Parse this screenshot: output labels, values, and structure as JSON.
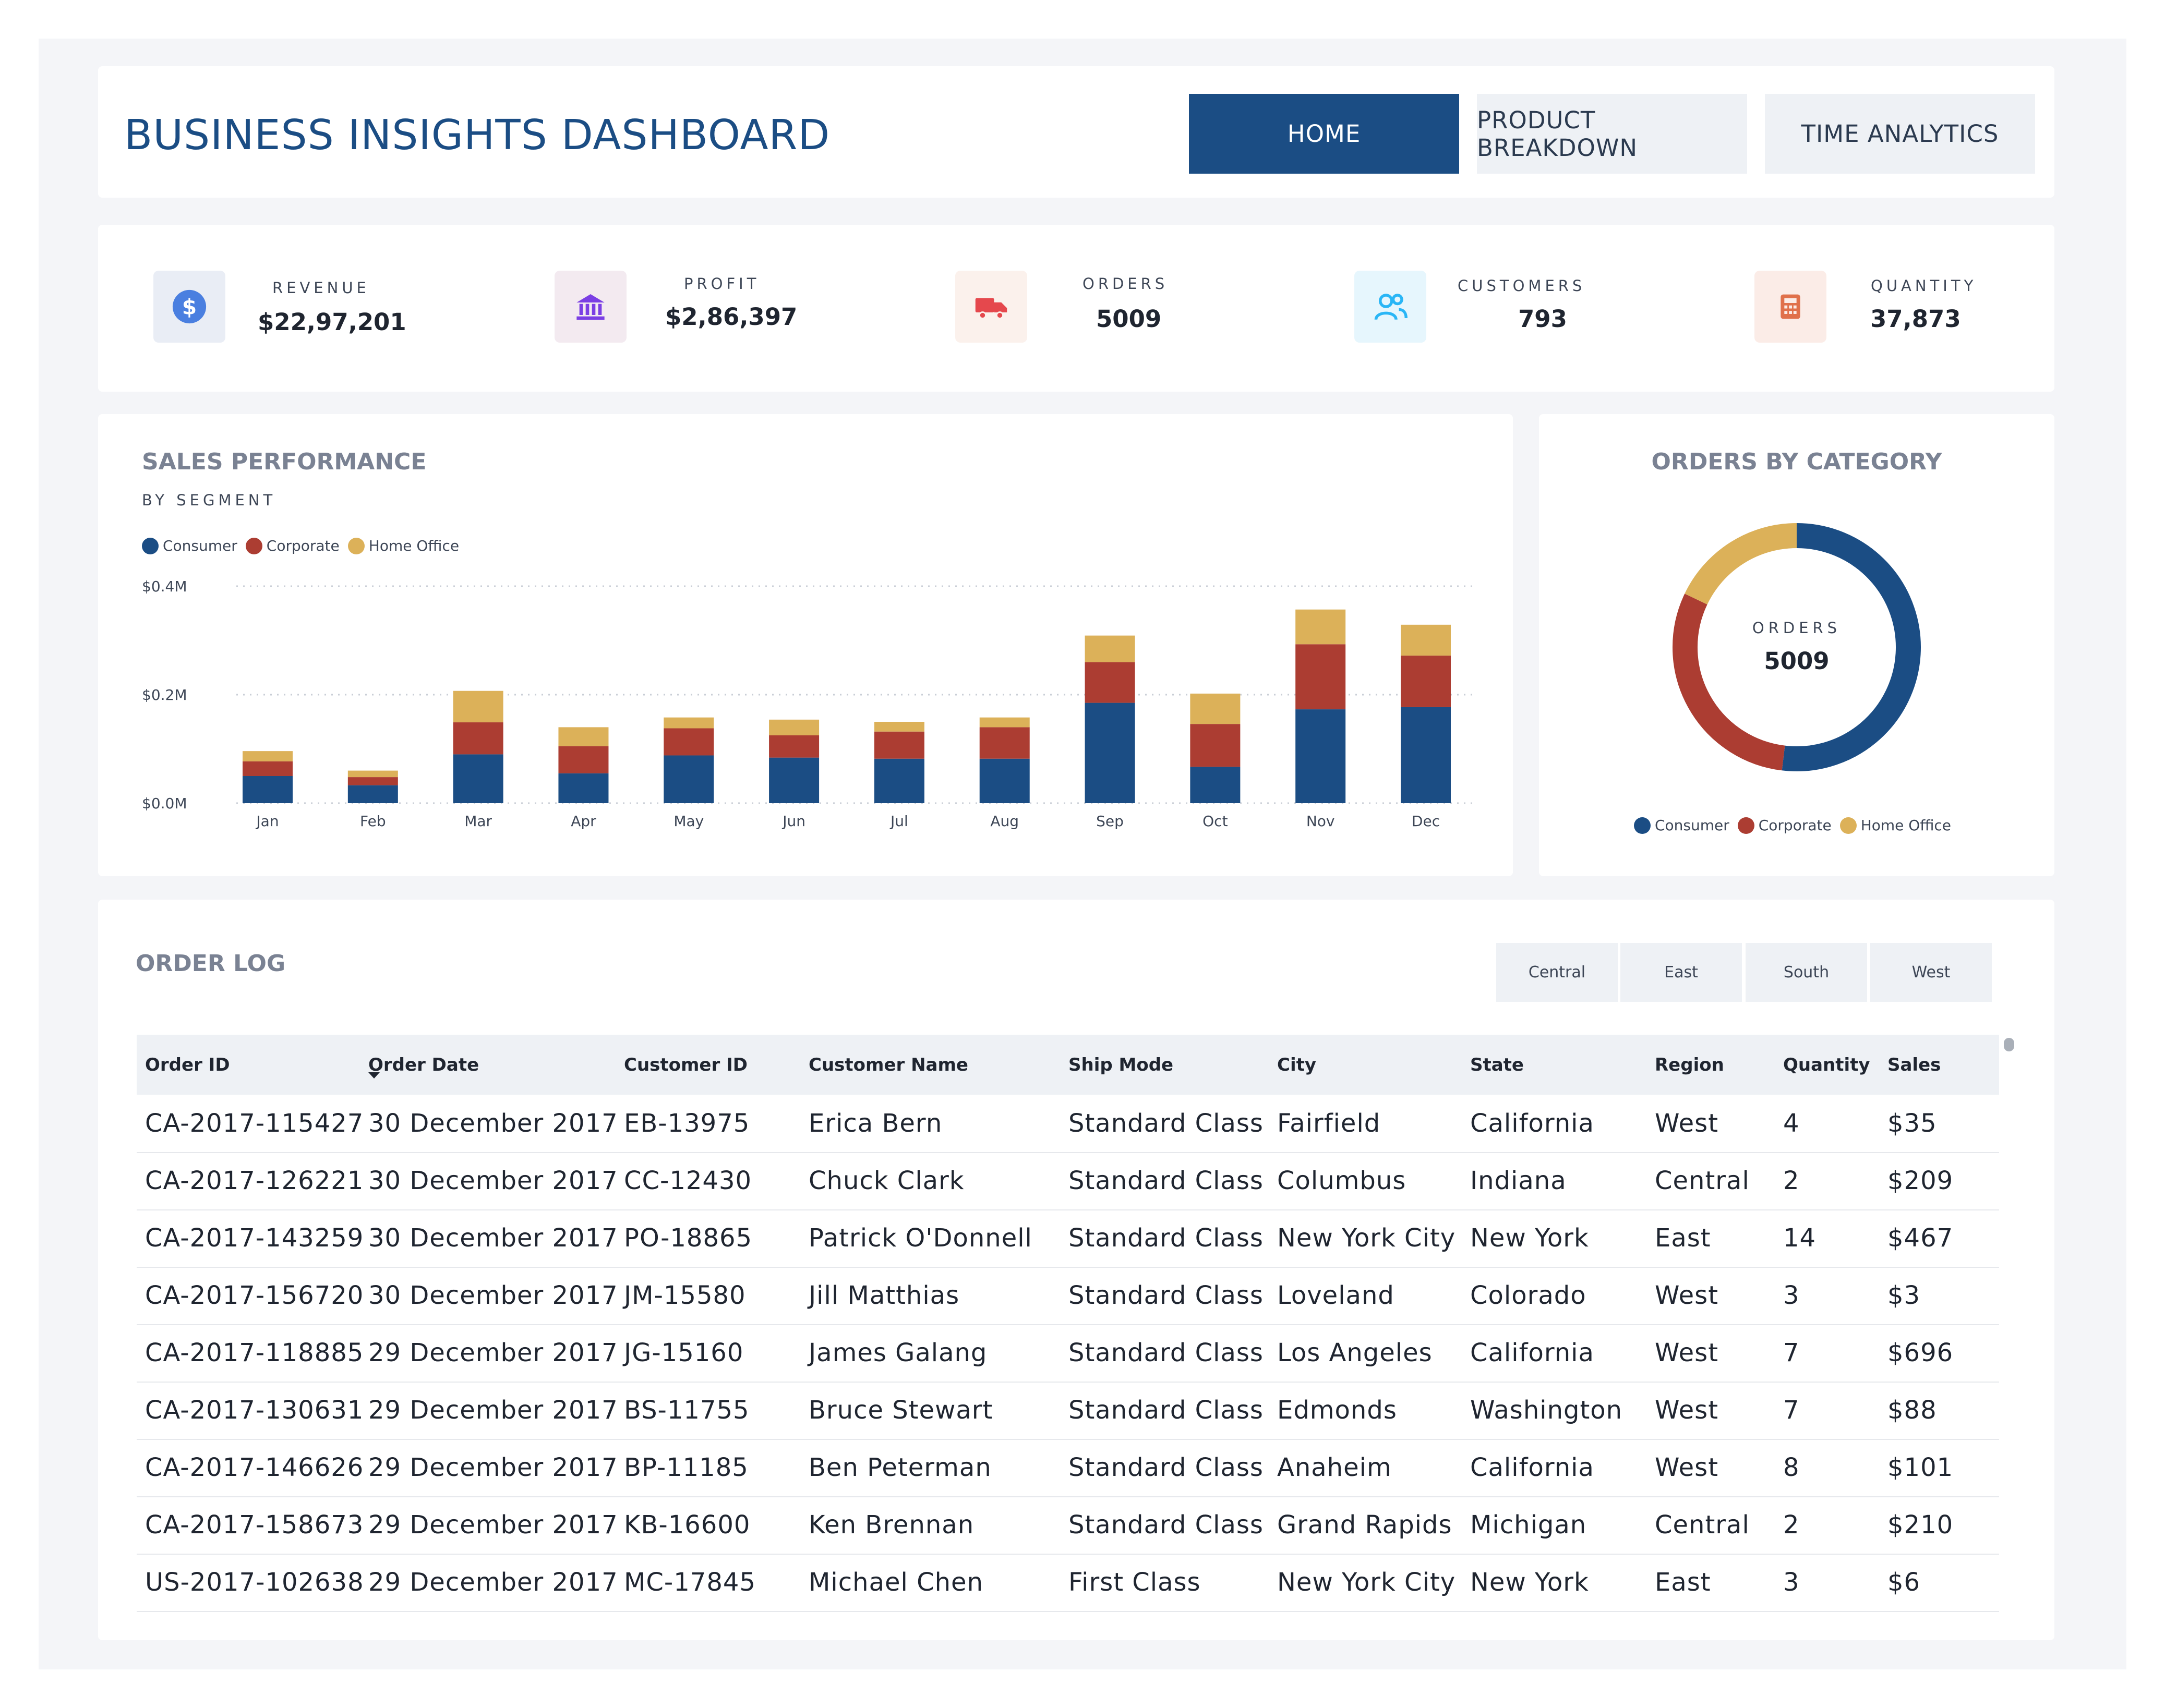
{
  "header": {
    "title": "BUSINESS INSIGHTS DASHBOARD",
    "nav": [
      "HOME",
      "PRODUCT BREAKDOWN",
      "TIME ANALYTICS"
    ],
    "active_nav": "HOME"
  },
  "kpis": [
    {
      "label": "REVENUE",
      "value": "$22,97,201",
      "icon": "dollar-icon",
      "color": "#4a7fe0"
    },
    {
      "label": "PROFIT",
      "value": "$2,86,397",
      "icon": "bank-icon",
      "color": "#7b3fe4"
    },
    {
      "label": "ORDERS",
      "value": "5009",
      "icon": "truck-icon",
      "color": "#e5484d"
    },
    {
      "label": "CUSTOMERS",
      "value": "793",
      "icon": "users-icon",
      "color": "#29b6f6"
    },
    {
      "label": "QUANTITY",
      "value": "37,873",
      "icon": "calculator-icon",
      "color": "#e0714b"
    }
  ],
  "sales": {
    "title": "SALES PERFORMANCE",
    "subtitle": "BY SEGMENT"
  },
  "chart_data": [
    {
      "type": "bar",
      "stacked": true,
      "categories": [
        "Jan",
        "Feb",
        "Mar",
        "Apr",
        "May",
        "Jun",
        "Jul",
        "Aug",
        "Sep",
        "Oct",
        "Nov",
        "Dec"
      ],
      "series": [
        {
          "name": "Consumer",
          "color": "#1b4d84",
          "values": [
            0.05,
            0.033,
            0.09,
            0.055,
            0.088,
            0.084,
            0.082,
            0.082,
            0.185,
            0.067,
            0.173,
            0.177
          ]
        },
        {
          "name": "Corporate",
          "color": "#ac3d32",
          "values": [
            0.027,
            0.015,
            0.059,
            0.05,
            0.05,
            0.041,
            0.05,
            0.058,
            0.075,
            0.079,
            0.12,
            0.095
          ]
        },
        {
          "name": "Home Office",
          "color": "#dcb159",
          "values": [
            0.019,
            0.012,
            0.058,
            0.035,
            0.02,
            0.029,
            0.018,
            0.018,
            0.049,
            0.056,
            0.064,
            0.057
          ]
        }
      ],
      "yticks": [
        "$0.0M",
        "$0.2M",
        "$0.4M"
      ],
      "ylim": [
        0,
        0.4
      ],
      "grid": true,
      "legend": "top-left"
    },
    {
      "type": "pie",
      "title": "ORDERS BY CATEGORY",
      "center_label": "ORDERS",
      "center_value": "5009",
      "categories": [
        "Consumer",
        "Corporate",
        "Home Office"
      ],
      "values": [
        51.9,
        30.2,
        17.9
      ],
      "colors": [
        "#1b4d84",
        "#ac3d32",
        "#dcb159"
      ],
      "legend": "bottom"
    }
  ],
  "orderlog": {
    "title": "ORDER LOG",
    "regions": [
      "Central",
      "East",
      "South",
      "West"
    ],
    "columns": [
      "Order ID",
      "Order Date",
      "Customer ID",
      "Customer Name",
      "Ship Mode",
      "City",
      "State",
      "Region",
      "Quantity",
      "Sales"
    ],
    "sorted_column": "Order Date",
    "rows": [
      [
        "CA-2017-115427",
        "30 December 2017",
        "EB-13975",
        "Erica Bern",
        "Standard Class",
        "Fairfield",
        "California",
        "West",
        "4",
        "$35"
      ],
      [
        "CA-2017-126221",
        "30 December 2017",
        "CC-12430",
        "Chuck Clark",
        "Standard Class",
        "Columbus",
        "Indiana",
        "Central",
        "2",
        "$209"
      ],
      [
        "CA-2017-143259",
        "30 December 2017",
        "PO-18865",
        "Patrick O'Donnell",
        "Standard Class",
        "New York City",
        "New York",
        "East",
        "14",
        "$467"
      ],
      [
        "CA-2017-156720",
        "30 December 2017",
        "JM-15580",
        "Jill Matthias",
        "Standard Class",
        "Loveland",
        "Colorado",
        "West",
        "3",
        "$3"
      ],
      [
        "CA-2017-118885",
        "29 December 2017",
        "JG-15160",
        "James Galang",
        "Standard Class",
        "Los Angeles",
        "California",
        "West",
        "7",
        "$696"
      ],
      [
        "CA-2017-130631",
        "29 December 2017",
        "BS-11755",
        "Bruce Stewart",
        "Standard Class",
        "Edmonds",
        "Washington",
        "West",
        "7",
        "$88"
      ],
      [
        "CA-2017-146626",
        "29 December 2017",
        "BP-11185",
        "Ben Peterman",
        "Standard Class",
        "Anaheim",
        "California",
        "West",
        "8",
        "$101"
      ],
      [
        "CA-2017-158673",
        "29 December 2017",
        "KB-16600",
        "Ken Brennan",
        "Standard Class",
        "Grand Rapids",
        "Michigan",
        "Central",
        "2",
        "$210"
      ],
      [
        "US-2017-102638",
        "29 December 2017",
        "MC-17845",
        "Michael Chen",
        "First Class",
        "New York City",
        "New York",
        "East",
        "3",
        "$6"
      ]
    ]
  }
}
